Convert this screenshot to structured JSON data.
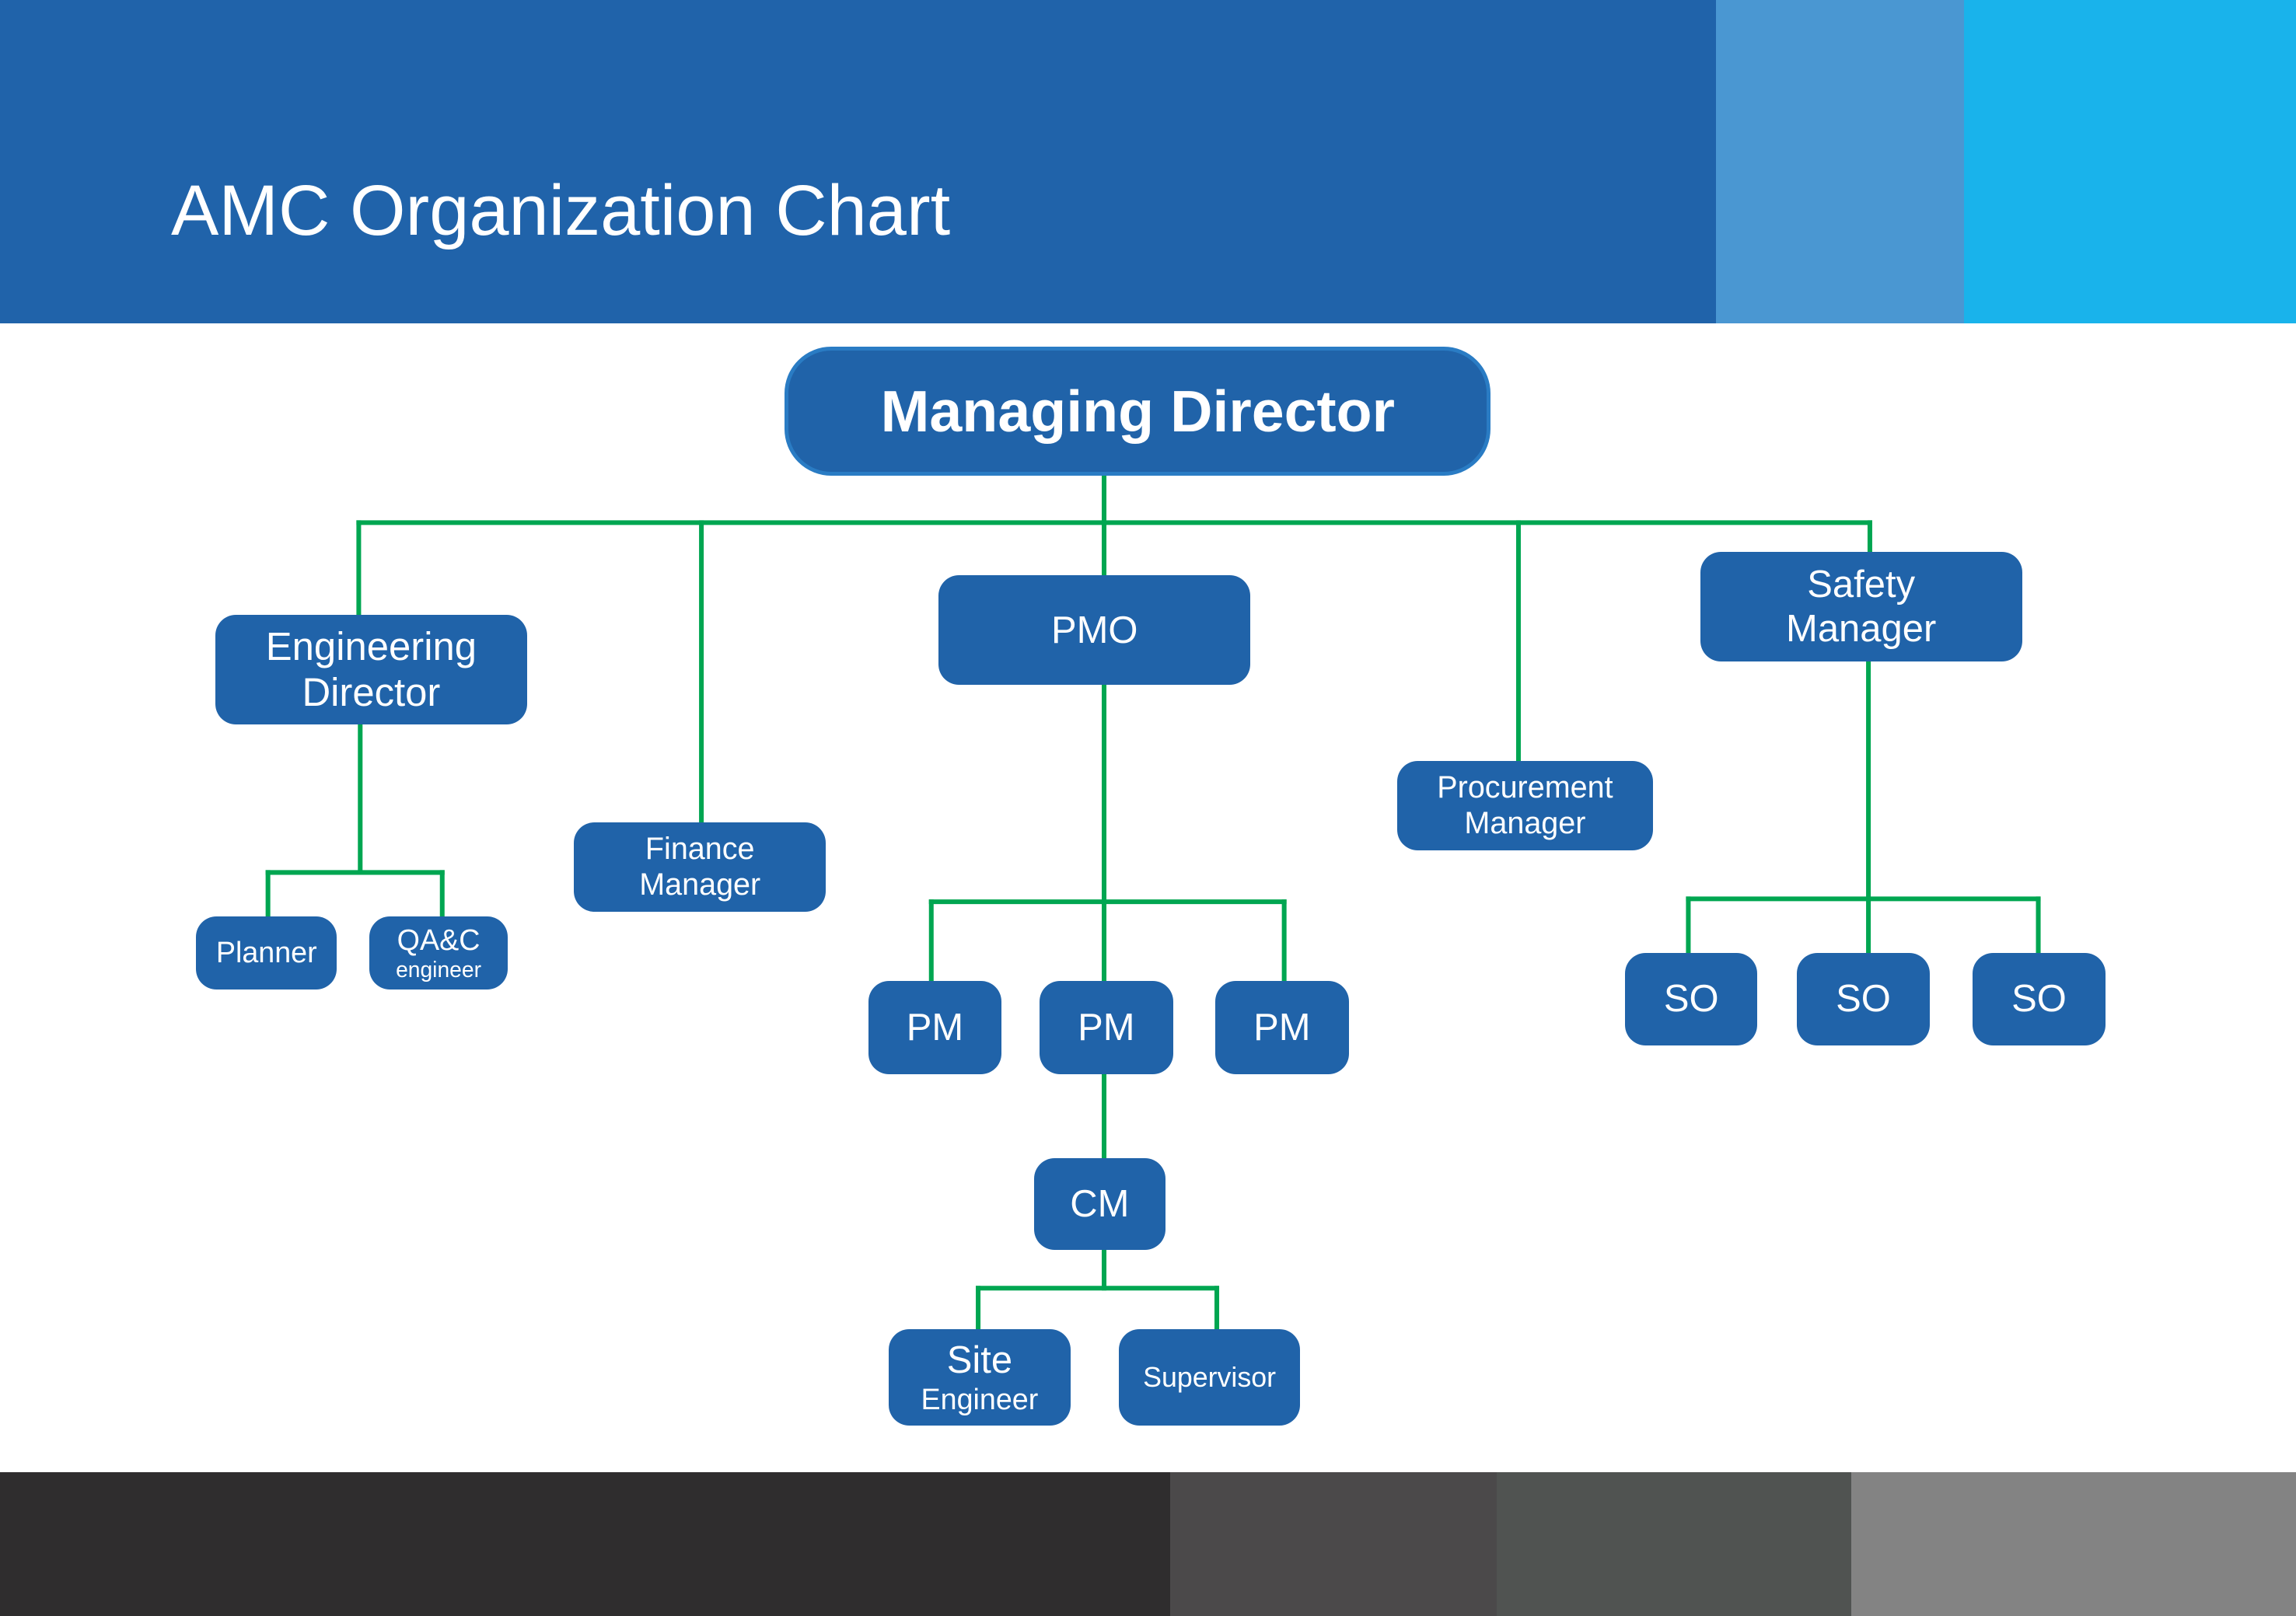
{
  "header": {
    "title": "AMC Organization Chart",
    "colors": {
      "main": "#2063aa",
      "strip_light": "#4a97d2",
      "strip_cyan": "#19b3eb"
    }
  },
  "footer": {
    "colors": [
      "#2f2d2e",
      "#4b494a",
      "#505351",
      "#838383"
    ]
  },
  "chart": {
    "node_color": "#2063a9",
    "connector_color": "#00a651",
    "root": {
      "id": "md",
      "label": "Managing Director"
    },
    "nodes": [
      {
        "id": "md",
        "lines": [
          "Managing Director"
        ],
        "parent": null
      },
      {
        "id": "eng",
        "lines": [
          "Engineering",
          "Director"
        ],
        "parent": "md"
      },
      {
        "id": "fin",
        "lines": [
          "Finance",
          "Manager"
        ],
        "parent": "md"
      },
      {
        "id": "pmo",
        "lines": [
          "PMO"
        ],
        "parent": "md"
      },
      {
        "id": "proc",
        "lines": [
          "Procurement",
          "Manager"
        ],
        "parent": "md"
      },
      {
        "id": "safety",
        "lines": [
          "Safety",
          "Manager"
        ],
        "parent": "md"
      },
      {
        "id": "planner",
        "lines": [
          "Planner"
        ],
        "parent": "eng"
      },
      {
        "id": "qac",
        "lines": [
          "QA&C",
          "engineer"
        ],
        "parent": "eng"
      },
      {
        "id": "pm1",
        "lines": [
          "PM"
        ],
        "parent": "pmo"
      },
      {
        "id": "pm2",
        "lines": [
          "PM"
        ],
        "parent": "pmo"
      },
      {
        "id": "pm3",
        "lines": [
          "PM"
        ],
        "parent": "pmo"
      },
      {
        "id": "cm",
        "lines": [
          "CM"
        ],
        "parent": "pm2"
      },
      {
        "id": "site",
        "lines": [
          "Site",
          "Engineer"
        ],
        "parent": "cm"
      },
      {
        "id": "sup",
        "lines": [
          "Supervisor"
        ],
        "parent": "cm"
      },
      {
        "id": "so1",
        "lines": [
          "SO"
        ],
        "parent": "safety"
      },
      {
        "id": "so2",
        "lines": [
          "SO"
        ],
        "parent": "safety"
      },
      {
        "id": "so3",
        "lines": [
          "SO"
        ],
        "parent": "safety"
      }
    ]
  }
}
